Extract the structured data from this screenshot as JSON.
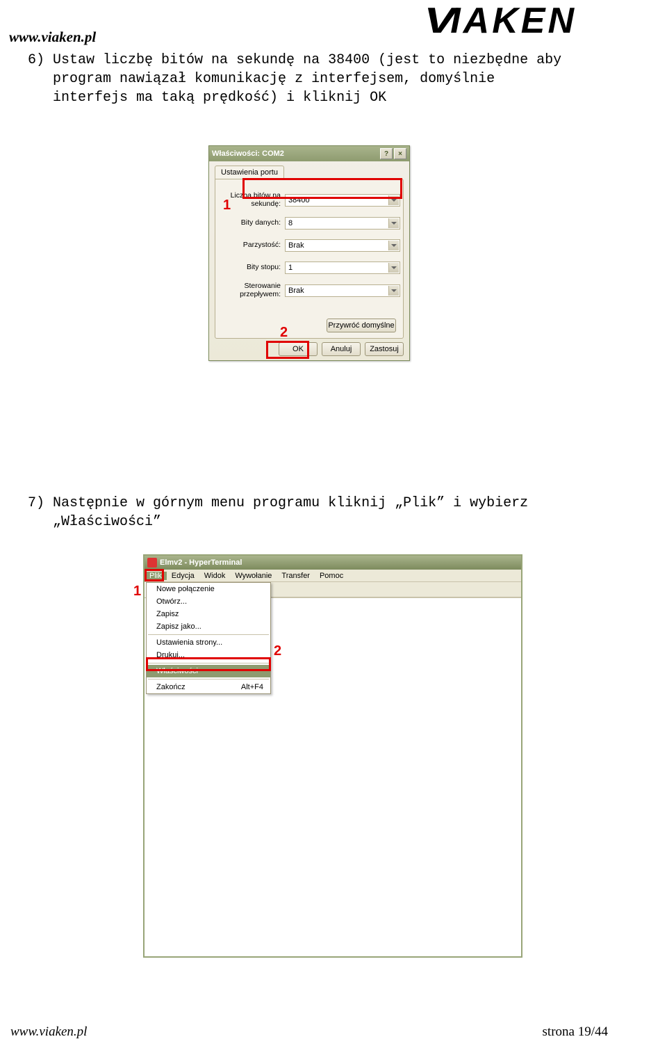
{
  "header": {
    "url": "www.viaken.pl",
    "logo_text": "VIAKEN"
  },
  "step6": {
    "text": "6) Ustaw liczbę bitów na sekundę na 38400 (jest to niezbędne aby\n   program nawiązał komunikację z interfejsem, domyślnie\n   interfejs ma taką prędkość) i kliknij OK"
  },
  "dialog1": {
    "title": "Właściwości: COM2",
    "help_btn": "?",
    "close_btn": "×",
    "tab": "Ustawienia portu",
    "fields": {
      "baud": {
        "label": "Liczba bitów na\nsekundę:",
        "value": "38400"
      },
      "data": {
        "label": "Bity danych:",
        "value": "8"
      },
      "parity": {
        "label": "Parzystość:",
        "value": "Brak"
      },
      "stop": {
        "label": "Bity stopu:",
        "value": "1"
      },
      "flow": {
        "label": "Sterowanie\nprzepływem:",
        "value": "Brak"
      }
    },
    "restore": "Przywróć domyślne",
    "ok": "OK",
    "cancel": "Anuluj",
    "apply": "Zastosuj",
    "marker1": "1",
    "marker2": "2"
  },
  "step7": {
    "text": "7) Następnie w górnym menu programu kliknij „Plik” i wybierz\n   „Właściwości”"
  },
  "ht": {
    "title": "Elmv2 - HyperTerminal",
    "menubar": [
      "Plik",
      "Edycja",
      "Widok",
      "Wywołanie",
      "Transfer",
      "Pomoc"
    ],
    "menu": {
      "new": "Nowe połączenie",
      "open": "Otwórz...",
      "save": "Zapisz",
      "saveas": "Zapisz jako...",
      "pagesetup": "Ustawienia strony...",
      "print": "Drukuj...",
      "props": "Właściwości",
      "exit": "Zakończ",
      "exit_accel": "Alt+F4"
    },
    "marker1": "1",
    "marker2": "2"
  },
  "footer": {
    "left": "www.viaken.pl",
    "right": "strona 19/44"
  }
}
